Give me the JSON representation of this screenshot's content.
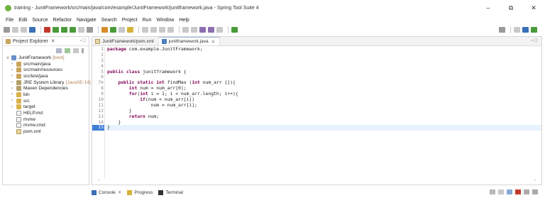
{
  "window": {
    "title": "training - JunitFramework/src/main/java/com/example/JunitFramework/junitframework.java - Spring Tool Suite 4",
    "minimize": "–",
    "maximize": "⧉",
    "close": "✕"
  },
  "menu": [
    "File",
    "Edit",
    "Source",
    "Refactor",
    "Navigate",
    "Search",
    "Project",
    "Run",
    "Window",
    "Help"
  ],
  "project_explorer": {
    "title": "Project Explorer",
    "close": "✕",
    "items": [
      {
        "label": "JunitFramework",
        "decor": "[boot]",
        "caret": "∨",
        "icon": "project-icon",
        "indent": 0
      },
      {
        "label": "src/main/java",
        "decor": "",
        "caret": "›",
        "icon": "source-folder-icon",
        "indent": 1
      },
      {
        "label": "src/main/resources",
        "decor": "",
        "caret": "›",
        "icon": "source-folder-icon",
        "indent": 1
      },
      {
        "label": "src/test/java",
        "decor": "",
        "caret": "›",
        "icon": "source-folder-icon",
        "indent": 1
      },
      {
        "label": "JRE System Library",
        "decor": "[JavaSE-14]",
        "caret": "›",
        "icon": "library-icon",
        "indent": 1
      },
      {
        "label": "Maven Dependencies",
        "decor": "",
        "caret": "›",
        "icon": "library-icon",
        "indent": 1
      },
      {
        "label": "bin",
        "decor": "",
        "caret": "›",
        "icon": "folder-icon",
        "indent": 1
      },
      {
        "label": "src",
        "decor": "",
        "caret": "›",
        "icon": "folder-icon",
        "indent": 1
      },
      {
        "label": "target",
        "decor": "",
        "caret": "›",
        "icon": "folder-icon",
        "indent": 1
      },
      {
        "label": "HELP.md",
        "decor": "",
        "caret": "",
        "icon": "file-icon",
        "indent": 1
      },
      {
        "label": "mvnw",
        "decor": "",
        "caret": "",
        "icon": "file-icon",
        "indent": 1
      },
      {
        "label": "mvnw.cmd",
        "decor": "",
        "caret": "",
        "icon": "file-icon",
        "indent": 1
      },
      {
        "label": "pom.xml",
        "decor": "",
        "caret": "",
        "icon": "xml-file-icon",
        "indent": 1
      }
    ]
  },
  "editor": {
    "tabs": [
      {
        "label": "JunitFramework/pom.xml",
        "active": false,
        "close": ""
      },
      {
        "label": "junitframework.java",
        "active": true,
        "close": "✕"
      }
    ],
    "lines": [
      {
        "n": "1",
        "code": "package com.example.JunitFramework;"
      },
      {
        "n": "2",
        "code": ""
      },
      {
        "n": "3",
        "code": ""
      },
      {
        "n": "4",
        "code": ""
      },
      {
        "n": "5",
        "code": "public class junitframework {"
      },
      {
        "n": "6",
        "code": ""
      },
      {
        "n": "7⊖",
        "code": "    public static int findMax (int num_arr []){"
      },
      {
        "n": "8",
        "code": "        int num = num_arr[0];"
      },
      {
        "n": "9",
        "code": "        for(int i = 1; i < num_arr.length; i++){"
      },
      {
        "n": "10",
        "code": "            if(num < num_arr[i])"
      },
      {
        "n": "11",
        "code": "                num = num_arr[i];"
      },
      {
        "n": "12",
        "code": "        }"
      },
      {
        "n": "13",
        "code": "        return num;"
      },
      {
        "n": "14",
        "code": "    }"
      },
      {
        "n": "15",
        "code": "}"
      }
    ],
    "current_line": 15,
    "scroll_left": "‹",
    "scroll_right": "›"
  },
  "bottom_tabs": [
    {
      "label": "Console",
      "close": "✕",
      "icon": "console-icon"
    },
    {
      "label": "Progress",
      "close": "",
      "icon": "progress-icon"
    },
    {
      "label": "Terminal",
      "close": "",
      "icon": "terminal-icon"
    }
  ],
  "colors": {
    "keyword": "#7f0055",
    "current_line_marker": "#3f7fd6",
    "current_line_bg": "#e8f2fe"
  }
}
